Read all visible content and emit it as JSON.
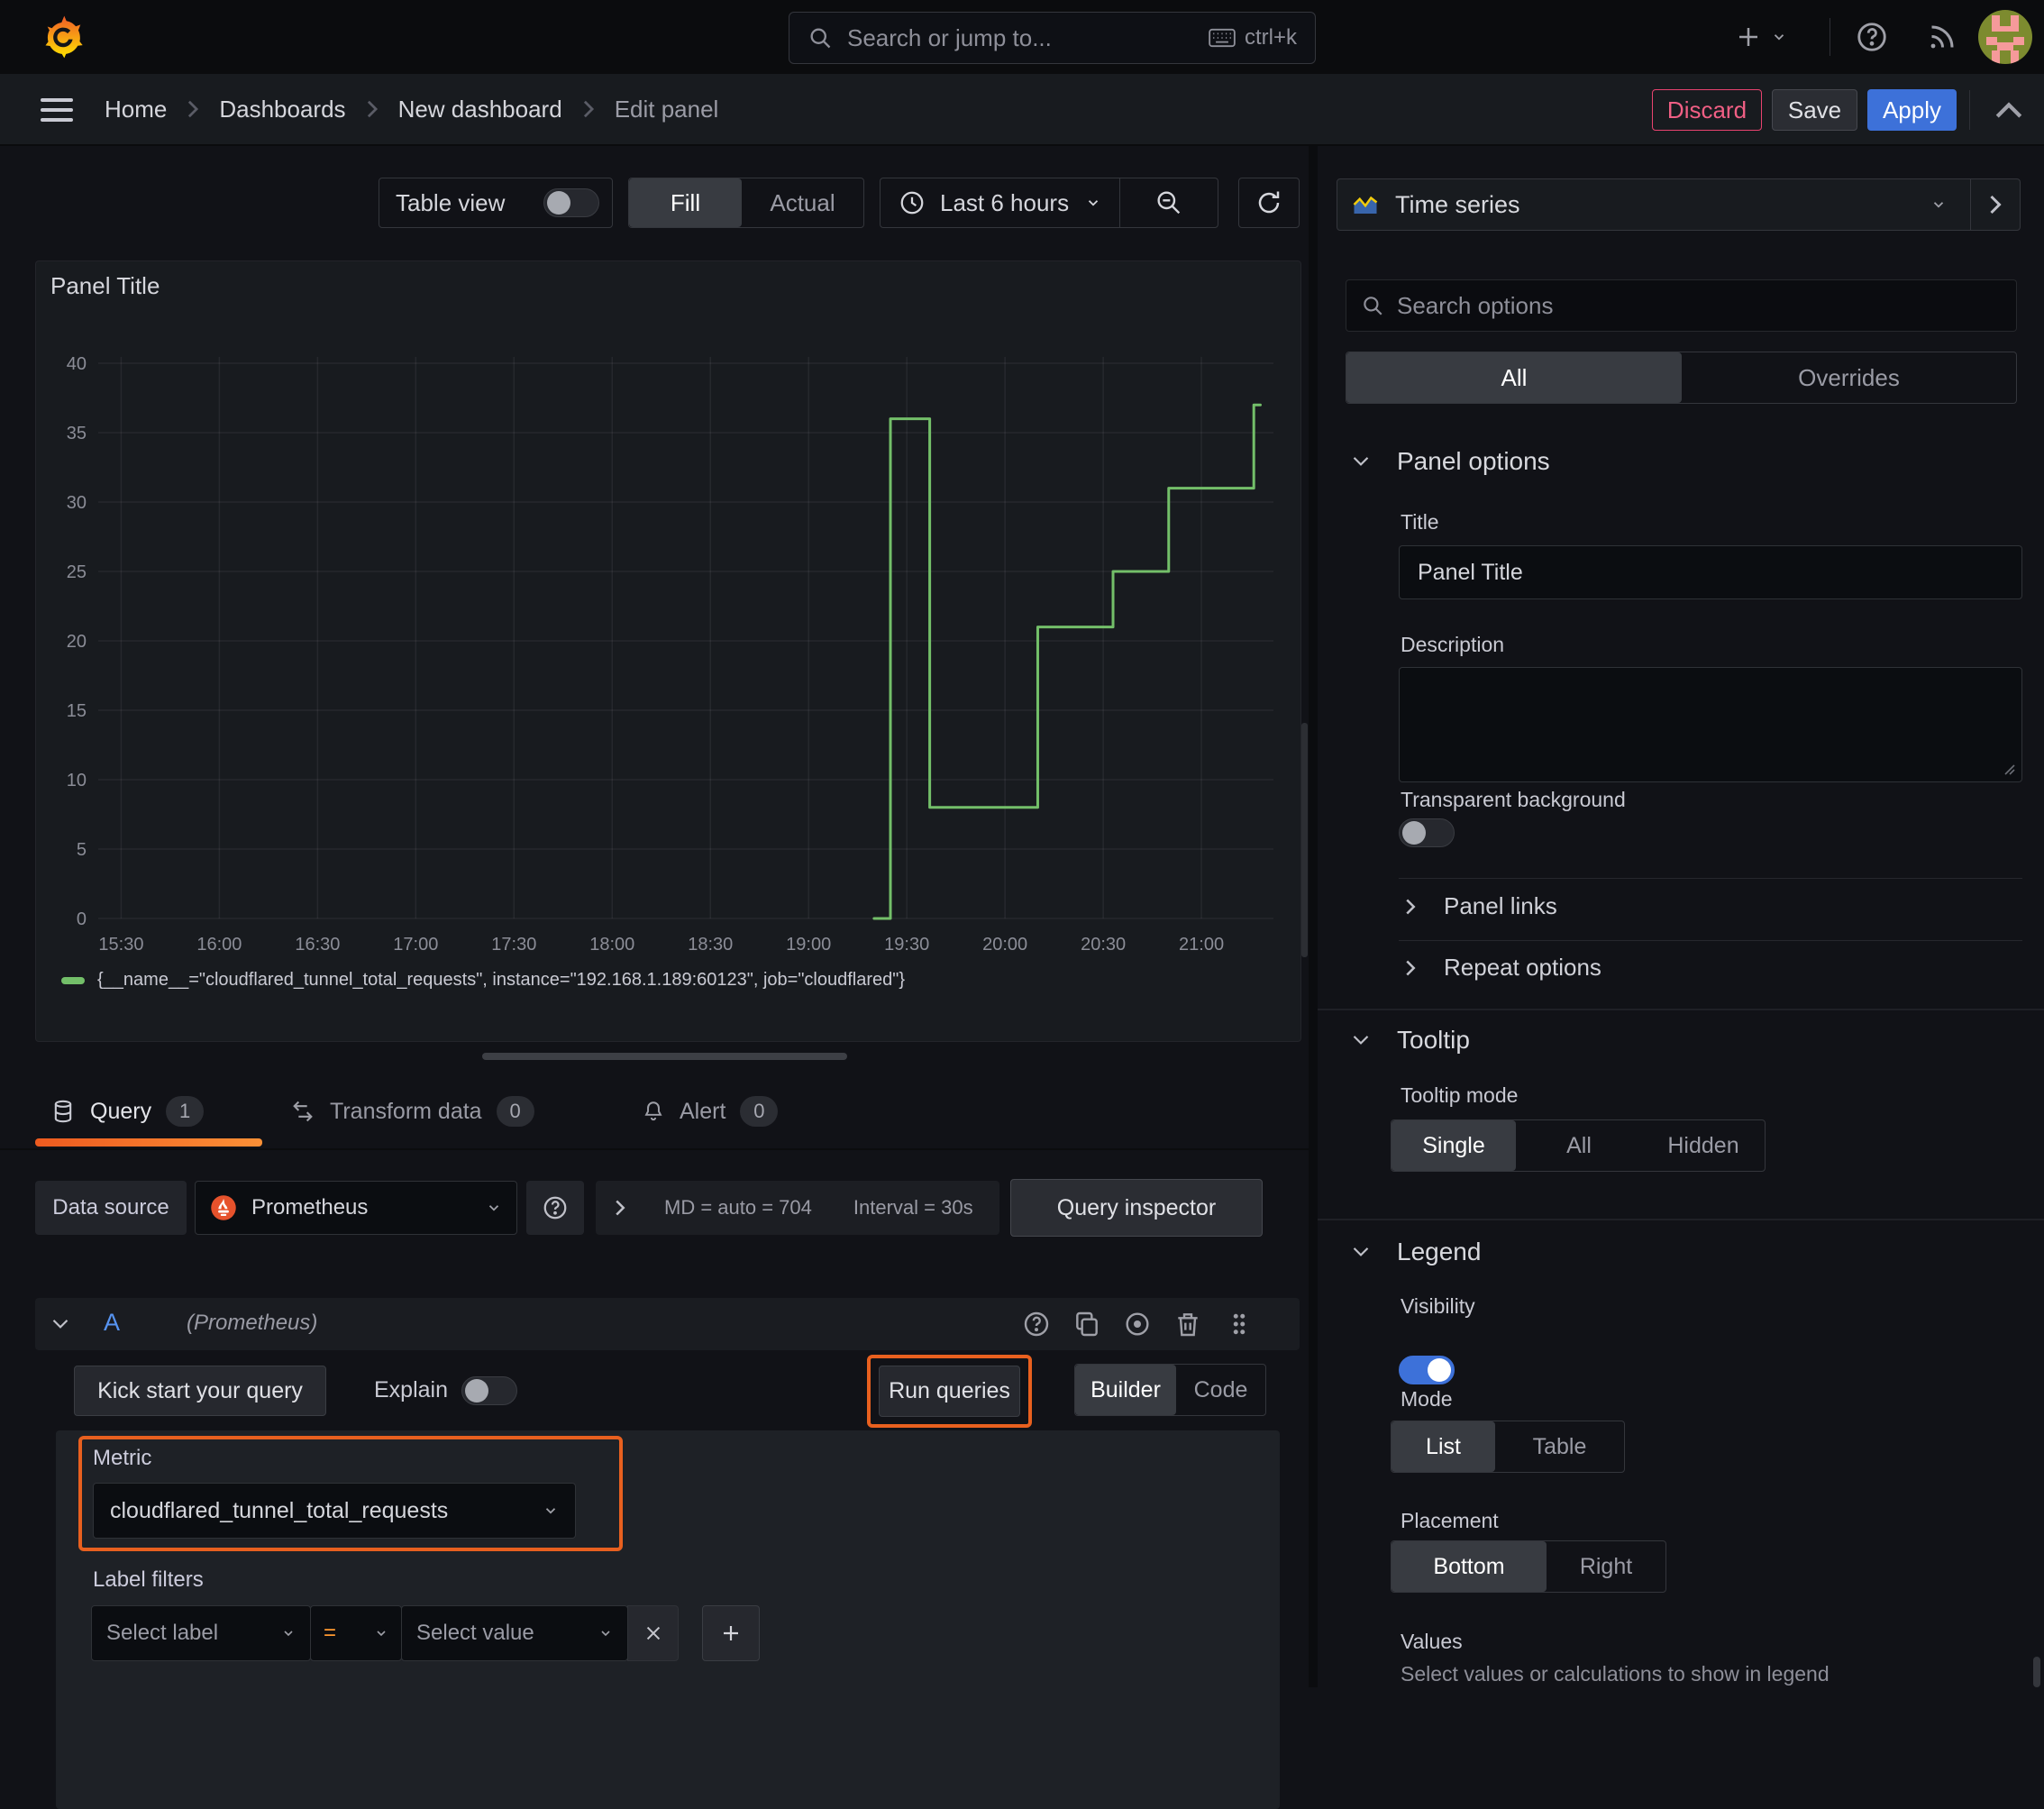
{
  "topbar": {
    "search_placeholder": "Search or jump to...",
    "search_shortcut": "ctrl+k"
  },
  "breadcrumb": {
    "items": [
      "Home",
      "Dashboards",
      "New dashboard",
      "Edit panel"
    ]
  },
  "actions": {
    "discard": "Discard",
    "save": "Save",
    "apply": "Apply"
  },
  "toolbar": {
    "table_view_label": "Table view",
    "fill_label": "Fill",
    "actual_label": "Actual",
    "time_range_label": "Last 6 hours"
  },
  "panel": {
    "title": "Panel Title"
  },
  "chart_data": {
    "type": "line",
    "line_interpolation": "step-after",
    "grid": true,
    "legend_position": "bottom",
    "title": "Panel Title",
    "xlabel": "",
    "ylabel": "",
    "x_ticks": [
      "15:30",
      "16:00",
      "16:30",
      "17:00",
      "17:30",
      "18:00",
      "18:30",
      "19:00",
      "19:30",
      "20:00",
      "20:30",
      "21:00"
    ],
    "y_ticks": [
      0,
      5,
      10,
      15,
      20,
      25,
      30,
      35,
      40
    ],
    "ylim": [
      0,
      40
    ],
    "x_range": [
      "15:23",
      "21:22"
    ],
    "series": [
      {
        "name": "{__name__=\"cloudflared_tunnel_total_requests\", instance=\"192.168.1.189:60123\", job=\"cloudflared\"}",
        "color": "#73bf69",
        "points": [
          [
            "19:20",
            0
          ],
          [
            "19:25",
            36
          ],
          [
            "19:37",
            8
          ],
          [
            "20:10",
            21
          ],
          [
            "20:33",
            25
          ],
          [
            "20:50",
            31
          ],
          [
            "21:16",
            37
          ],
          [
            "21:18",
            37
          ]
        ]
      }
    ]
  },
  "tabs": {
    "query": {
      "label": "Query",
      "count": "1"
    },
    "transform": {
      "label": "Transform data",
      "count": "0"
    },
    "alert": {
      "label": "Alert",
      "count": "0"
    }
  },
  "datasource_row": {
    "label": "Data source",
    "value": "Prometheus",
    "options_summary": "MD = auto = 704",
    "interval": "Interval = 30s",
    "inspector": "Query inspector"
  },
  "query_editor": {
    "refid": "A",
    "datasource_hint": "(Prometheus)",
    "kickstart": "Kick start your query",
    "explain": "Explain",
    "run_queries": "Run queries",
    "builder": "Builder",
    "code": "Code",
    "metric_label": "Metric",
    "metric_value": "cloudflared_tunnel_total_requests",
    "label_filters_label": "Label filters",
    "select_label_placeholder": "Select label",
    "operator": "=",
    "select_value_placeholder": "Select value"
  },
  "sidebar": {
    "visualization": "Time series",
    "search_placeholder": "Search options",
    "filter_tabs": {
      "all": "All",
      "overrides": "Overrides"
    },
    "panel_options": {
      "heading": "Panel options",
      "title_label": "Title",
      "title_value": "Panel Title",
      "description_label": "Description",
      "transparent_label": "Transparent background"
    },
    "collapsed": {
      "panel_links": "Panel links",
      "repeat_options": "Repeat options"
    },
    "tooltip": {
      "heading": "Tooltip",
      "mode_label": "Tooltip mode",
      "single": "Single",
      "all": "All",
      "hidden": "Hidden"
    },
    "legend": {
      "heading": "Legend",
      "visibility_label": "Visibility",
      "mode_label": "Mode",
      "list": "List",
      "table": "Table",
      "placement_label": "Placement",
      "bottom": "Bottom",
      "right": "Right",
      "values_label": "Values",
      "values_desc": "Select values or calculations to show in legend"
    }
  },
  "colors": {
    "accent_blue": "#3d71d9",
    "highlight_orange": "#e8601f",
    "series_green": "#73bf69",
    "discard_pink": "#e8436f",
    "tab_active_orange": "#ed5a1f"
  }
}
